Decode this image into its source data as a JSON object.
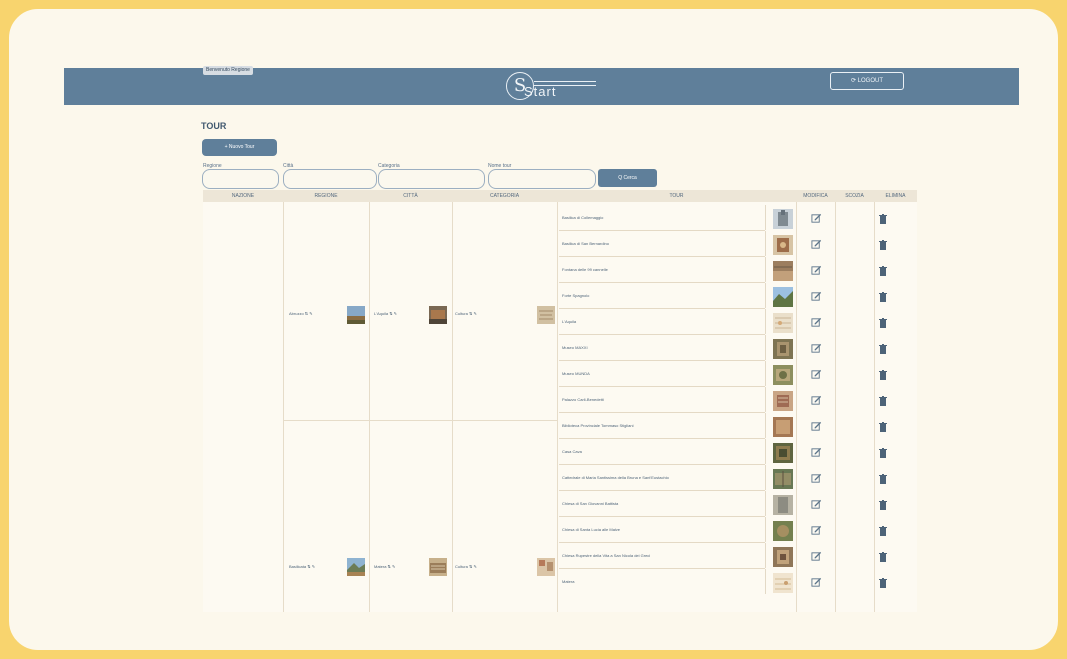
{
  "header": {
    "user_badge": "Benvenuto Regione",
    "logo_text": "Start",
    "logout_label": "⟳ LOGOUT"
  },
  "page": {
    "title": "TOUR",
    "new_button": "+ Nuovo Tour"
  },
  "filters": {
    "region_label": "Regione",
    "city_label": "Città",
    "category_label": "Categoria",
    "tour_label": "Nome tour",
    "search_button": "Q Cerca"
  },
  "table": {
    "headers": [
      "NAZIONE",
      "REGIONE",
      "CITTÀ",
      "CATEGORIA",
      "TOUR",
      "MODIFICA",
      "SCOZIA",
      "ELIMINA"
    ],
    "groups": [
      {
        "region": "Abruzzo ⇅ ✎",
        "city": "L'Aquila ⇅ ✎",
        "category": "Cultura ⇅ ✎",
        "tours": [
          "Basilica di Collemaggio",
          "Basilica di San Bernardino",
          "Fontana delle 99 cannelle",
          "Forte Spagnolo",
          "L'Aquila",
          "Museo MAXXI",
          "Museo MUNDA",
          "Palazzo Carli-Benedetti"
        ]
      },
      {
        "region": "Basilicata ⇅ ✎",
        "city": "Matera ⇅ ✎",
        "category": "Cultura ⇅ ✎",
        "tours": [
          "Biblioteca Provinciale Tommaso Stigliani",
          "Casa Cava",
          "Cattedrale di Maria Santissima della Bruna e Sant'Eustachio",
          "Chiesa di San Giovanni Battista",
          "Chiesa di Santa Lucia alle Malve",
          "Chiesa Rupestre della Vita a San Nicola dei Greci",
          "Matera"
        ]
      }
    ]
  },
  "icons": {
    "edit": "edit-icon",
    "delete": "trash-icon"
  },
  "colors": {
    "background": "#f8d46e",
    "page": "#fcf8ec",
    "brand": "#5f7f9a"
  }
}
